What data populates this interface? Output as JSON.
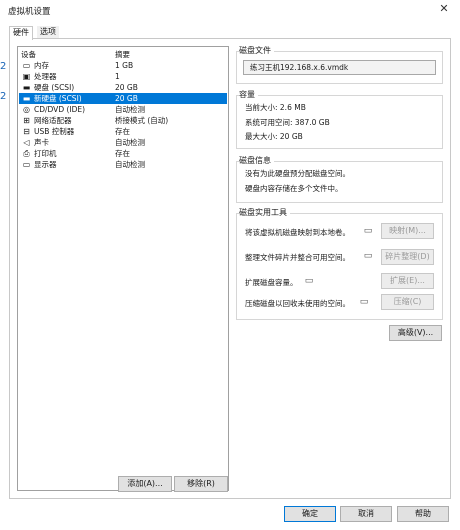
{
  "window": {
    "title": "虚拟机设置"
  },
  "tabs": [
    {
      "label": "硬件"
    },
    {
      "label": "选项"
    }
  ],
  "device_list": {
    "headers": {
      "device": "设备",
      "summary": "摘要"
    },
    "rows": [
      {
        "icon": "memory-icon",
        "name": "内存",
        "summary": "1 GB"
      },
      {
        "icon": "processor-icon",
        "name": "处理器",
        "summary": "1"
      },
      {
        "icon": "hard-disk-icon",
        "name": "硬盘 (SCSI)",
        "summary": "20 GB"
      },
      {
        "icon": "hard-disk-icon",
        "name": "新硬盘 (SCSI)",
        "summary": "20 GB",
        "selected": true
      },
      {
        "icon": "cd-dvd-icon",
        "name": "CD/DVD (IDE)",
        "summary": "自动检测"
      },
      {
        "icon": "network-adapter-icon",
        "name": "网络适配器",
        "summary": "桥接模式 (自动)"
      },
      {
        "icon": "usb-icon",
        "name": "USB 控制器",
        "summary": "存在"
      },
      {
        "icon": "sound-card-icon",
        "name": "声卡",
        "summary": "自动检测"
      },
      {
        "icon": "printer-icon",
        "name": "打印机",
        "summary": "存在"
      },
      {
        "icon": "display-icon",
        "name": "显示器",
        "summary": "自动检测"
      }
    ],
    "add_label": "添加(A)...",
    "remove_label": "移除(R)"
  },
  "disk_file": {
    "title": "磁盘文件",
    "value": "练习王机192.168.x.6.vmdk"
  },
  "capacity": {
    "title": "容量",
    "current": "当前大小: 2.6 MB",
    "available": "系统可用空间: 387.0 GB",
    "max": "最大大小: 20 GB"
  },
  "disk_info": {
    "title": "磁盘信息",
    "line1": "没有为此硬盘预分配磁盘空间。",
    "line2": "硬盘内容存储在多个文件中。"
  },
  "utilities": {
    "title": "磁盘实用工具",
    "map_text": "将该虚拟机磁盘映射到本地卷。",
    "map_button": "映射(M)...",
    "defrag_text": "整理文件碎片并整合可用空间。",
    "defrag_button": "碎片整理(D)",
    "expand_text": "扩展磁盘容量。",
    "expand_button": "扩展(E)...",
    "compact_text": "压缩磁盘以回收未使用的空间。",
    "compact_button": "压缩(C)"
  },
  "advanced_label": "高级(V)...",
  "footer": {
    "ok": "确定",
    "cancel": "取消",
    "help": "帮助"
  },
  "window_controls": {
    "close_glyph": "✕"
  },
  "background_edge": {
    "glyph1": "2",
    "glyph2": "2"
  },
  "colors": {
    "selection": "#0078d7",
    "panel_border": "#c8c8c8"
  }
}
